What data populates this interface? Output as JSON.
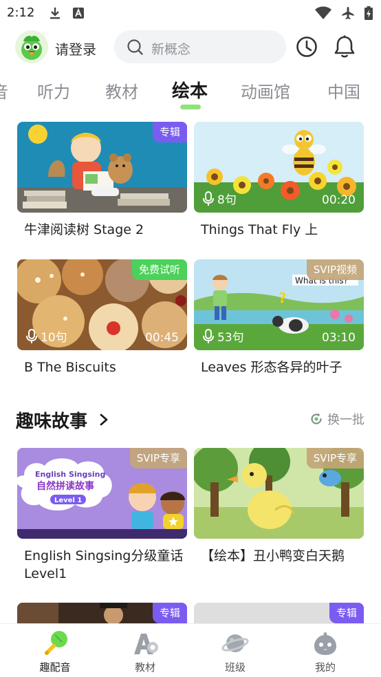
{
  "status_bar": {
    "time": "2:12",
    "left_icons": [
      "download-icon",
      "text-a-icon"
    ],
    "right_icons": [
      "wifi-icon",
      "airplane-icon",
      "battery-charging-icon"
    ]
  },
  "header": {
    "login_label": "请登录",
    "search_placeholder": "新概念",
    "avatar_icon": "parrot-avatar-icon",
    "history_icon": "clock-icon",
    "notification_icon": "bell-icon"
  },
  "tabs": [
    {
      "label": "音",
      "active": false
    },
    {
      "label": "听力",
      "active": false
    },
    {
      "label": "教材",
      "active": false
    },
    {
      "label": "绘本",
      "active": true
    },
    {
      "label": "动画馆",
      "active": false
    },
    {
      "label": "中国",
      "active": false
    }
  ],
  "accent_color": "#8ee37a",
  "cards": [
    {
      "title": "牛津阅读树 Stage 2",
      "badge": "专辑",
      "badge_style": "purple",
      "sentences": "",
      "duration": ""
    },
    {
      "title": "Things That Fly 上",
      "badge": "",
      "badge_style": "",
      "sentences": "8句",
      "duration": "00:20"
    },
    {
      "title": "B The Biscuits",
      "badge": "免费试听",
      "badge_style": "green",
      "sentences": "10句",
      "duration": "00:45"
    },
    {
      "title": "Leaves 形态各异的叶子",
      "badge": "SVIP视频",
      "badge_style": "tan",
      "sentences": "53句",
      "duration": "03:10",
      "overlay_text": "What is this?"
    }
  ],
  "section": {
    "title": "趣味故事",
    "refresh_label": "换一批"
  },
  "story_cards": [
    {
      "title": "English Singsing分级童话Level1",
      "badge": "SVIP专享",
      "art_line1": "English Singsing",
      "art_line2": "自然拼读故事",
      "art_line3": "Level 1"
    },
    {
      "title": "【绘本】丑小鸭变白天鹅",
      "badge": "SVIP专享"
    }
  ],
  "partial_cards": [
    {
      "badge": "专辑"
    },
    {
      "badge": "专辑"
    }
  ],
  "bottom_nav": [
    {
      "label": "趣配音",
      "icon": "microphone-icon",
      "active": true
    },
    {
      "label": "教材",
      "icon": "textbook-icon",
      "active": false
    },
    {
      "label": "班级",
      "icon": "planet-icon",
      "active": false
    },
    {
      "label": "我的",
      "icon": "profile-icon",
      "active": false
    }
  ]
}
